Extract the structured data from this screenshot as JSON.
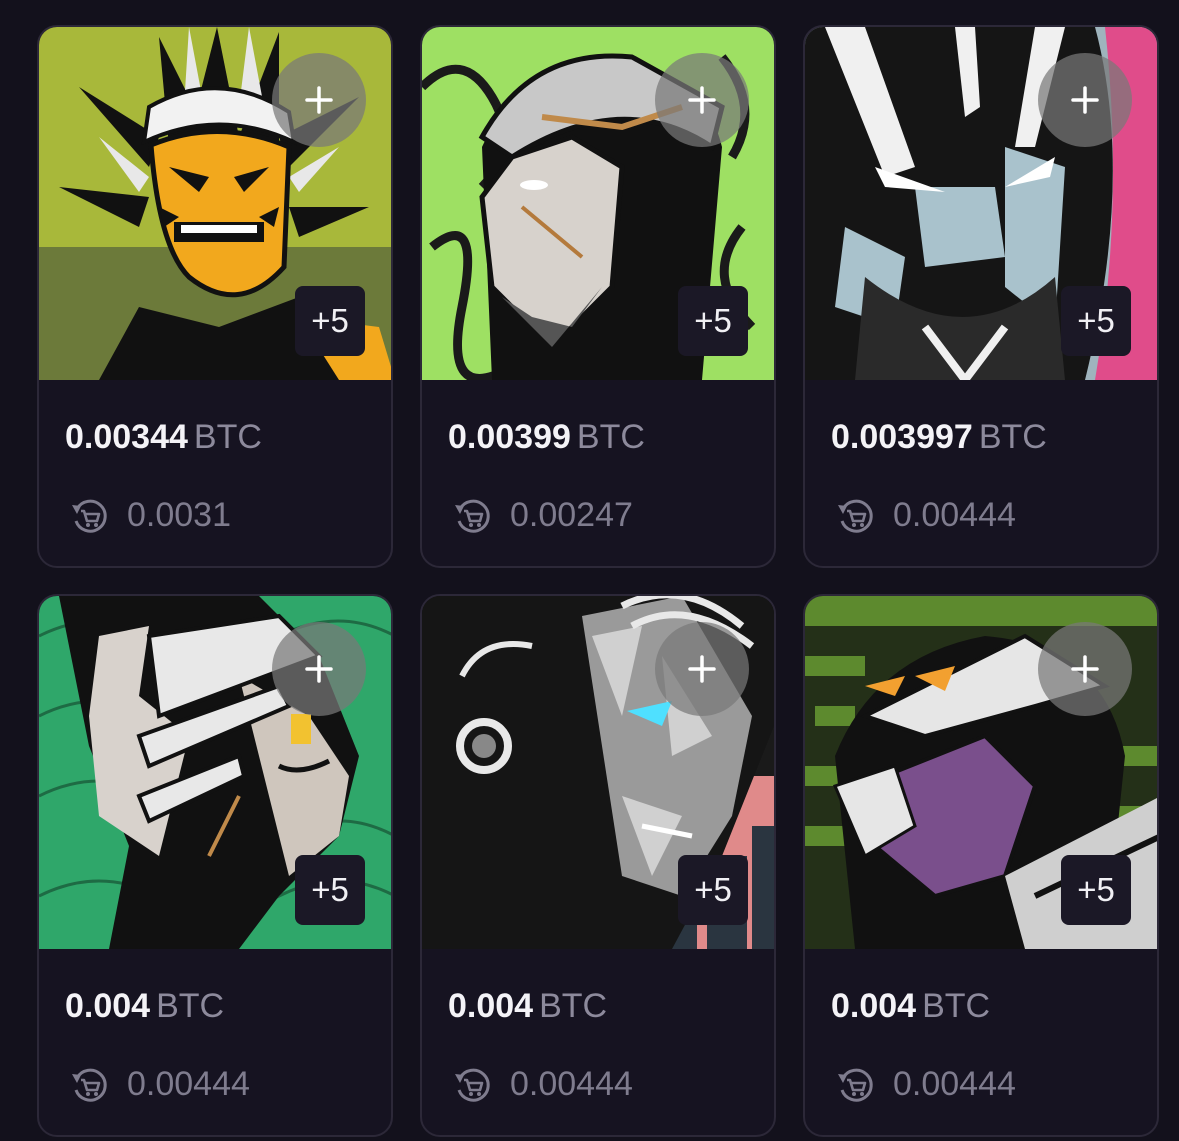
{
  "icons": {
    "add": "plus-icon",
    "offer": "cart-refresh-icon"
  },
  "colors": {
    "background": "#13111c",
    "card": "#161321",
    "border": "#2c2838",
    "price": "#f4f3f7",
    "currency": "#8d8a9c",
    "muted": "#7f7c8e"
  },
  "cards": [
    {
      "price": "0.00344",
      "currency": "BTC",
      "more": "+5",
      "offer": "0.0031"
    },
    {
      "price": "0.00399",
      "currency": "BTC",
      "more": "+5",
      "offer": "0.00247"
    },
    {
      "price": "0.003997",
      "currency": "BTC",
      "more": "+5",
      "offer": "0.00444"
    },
    {
      "price": "0.004",
      "currency": "BTC",
      "more": "+5",
      "offer": "0.00444"
    },
    {
      "price": "0.004",
      "currency": "BTC",
      "more": "+5",
      "offer": "0.00444"
    },
    {
      "price": "0.004",
      "currency": "BTC",
      "more": "+5",
      "offer": "0.00444"
    }
  ]
}
